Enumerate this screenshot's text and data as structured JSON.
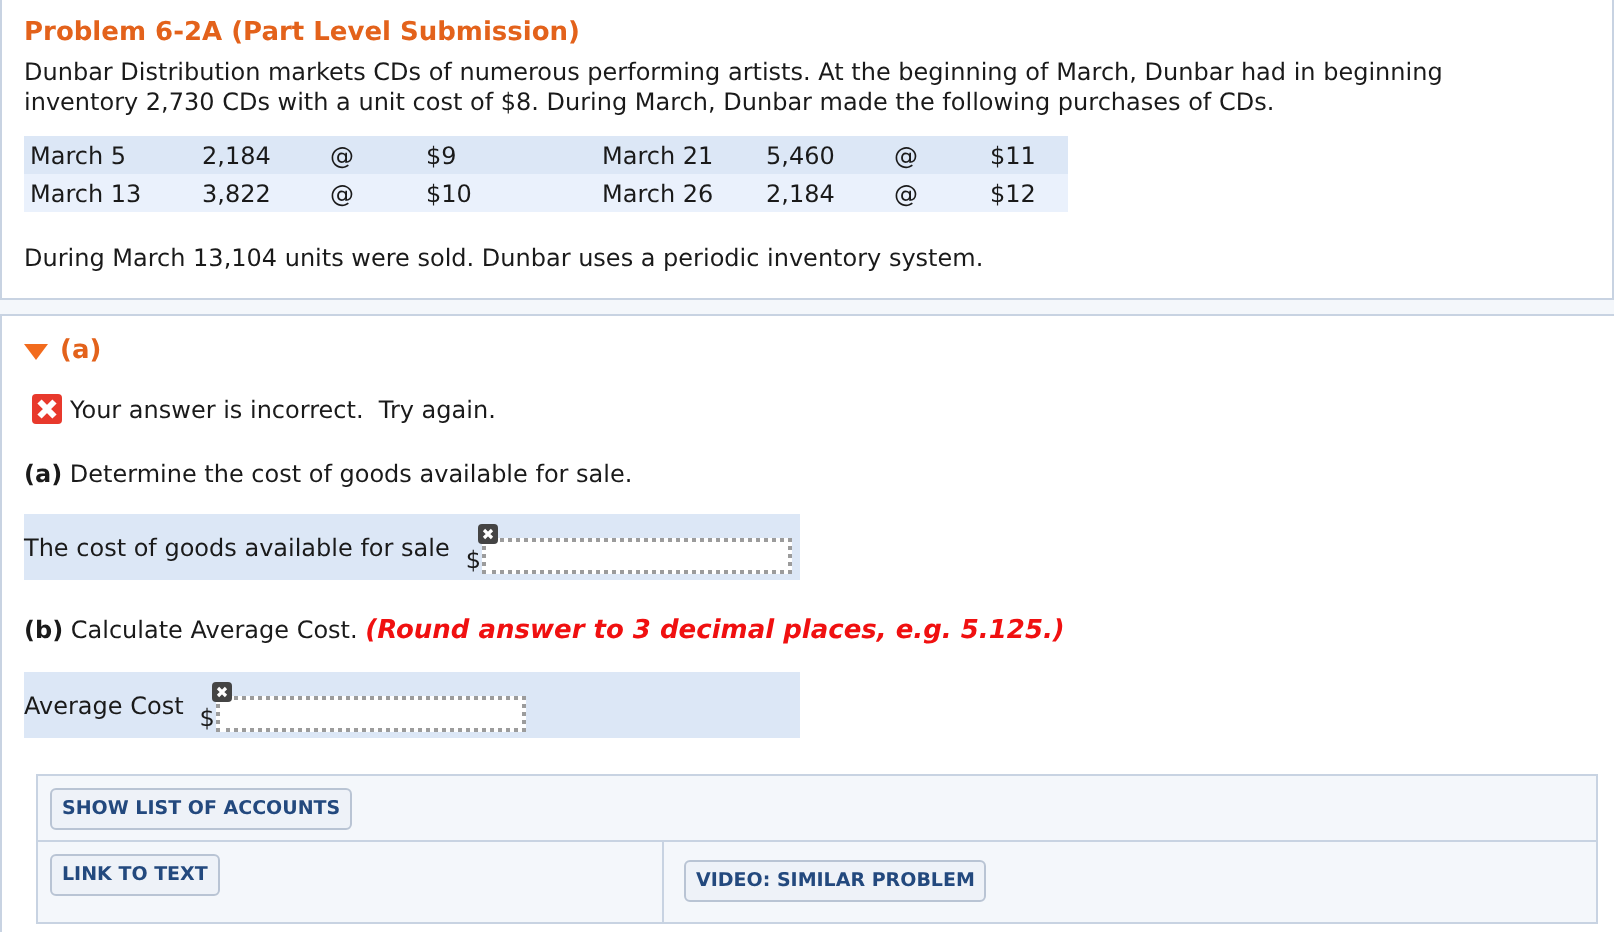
{
  "problem": {
    "title": "Problem 6-2A (Part Level Submission)",
    "text": "Dunbar Distribution markets CDs of numerous performing artists. At the beginning of March, Dunbar had in beginning inventory 2,730 CDs with a unit cost of $8. During March, Dunbar made the following purchases of CDs.",
    "purchase_rows": [
      {
        "cells": [
          "March 5",
          "2,184",
          "@",
          "$9",
          "March 21",
          "5,460",
          "@",
          "$11"
        ]
      },
      {
        "cells": [
          "March 13",
          "3,822",
          "@",
          "$10",
          "March 26",
          "2,184",
          "@",
          "$12"
        ]
      }
    ],
    "footer": "During March 13,104 units were sold. Dunbar uses a periodic inventory system."
  },
  "part": {
    "label": "(a)",
    "expanded": true,
    "feedback": "Your answer is incorrect.  Try again.",
    "questions": [
      {
        "label": "(a)",
        "text": "Determine the cost of goods available for sale.",
        "field_label": "The cost of goods available for sale",
        "currency": "$"
      },
      {
        "label": "(b)",
        "text": "Calculate Average Cost.",
        "note": "(Round answer to 3 decimal places, e.g. 5.125.)",
        "field_label": "Average Cost",
        "currency": "$"
      }
    ],
    "buttons": {
      "accounts": "SHOW LIST OF ACCOUNTS",
      "link": "LINK TO TEXT",
      "video": "VIDEO: SIMILAR PROBLEM"
    }
  }
}
